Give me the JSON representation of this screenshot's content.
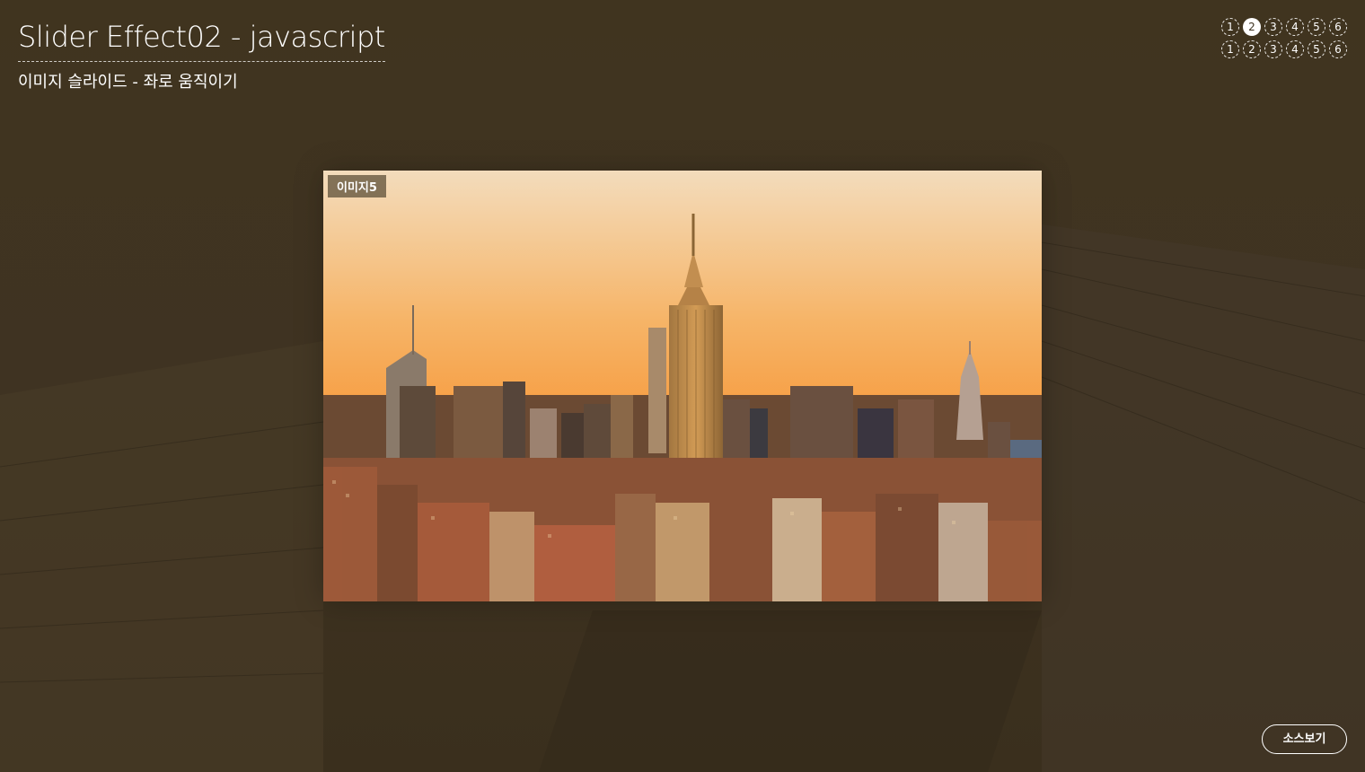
{
  "header": {
    "title": "Slider Effect02 - javascript",
    "subtitle": "이미지 슬라이드 - 좌로 움직이기"
  },
  "navigation": {
    "row1": [
      "1",
      "2",
      "3",
      "4",
      "5",
      "6"
    ],
    "row2": [
      "1",
      "2",
      "3",
      "4",
      "5",
      "6"
    ],
    "active_row1_index": 1
  },
  "slider": {
    "current_label": "이미지5",
    "image_subject": "city-skyline-at-sunset"
  },
  "footer": {
    "source_button_label": "소스보기"
  },
  "colors": {
    "background": "#3e3321",
    "text": "#ffffff",
    "sky_top": "#f2d7b4",
    "sky_bottom": "#f79a3c"
  }
}
